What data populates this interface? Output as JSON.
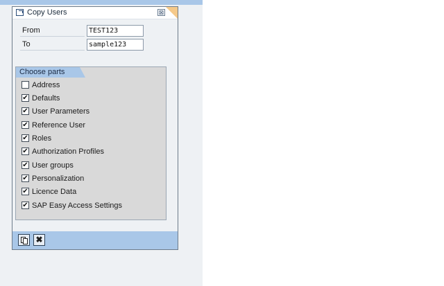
{
  "dialog": {
    "title": "Copy Users",
    "close_glyph": "⊠",
    "fields": [
      {
        "label": "From",
        "value": "TEST123"
      },
      {
        "label": "To",
        "value": "sample123"
      }
    ],
    "group": {
      "title": "Choose parts",
      "items": [
        {
          "label": "Address",
          "checked": false
        },
        {
          "label": "Defaults",
          "checked": true
        },
        {
          "label": "User Parameters",
          "checked": true
        },
        {
          "label": "Reference User",
          "checked": true
        },
        {
          "label": "Roles",
          "checked": true
        },
        {
          "label": "Authorization Profiles",
          "checked": true
        },
        {
          "label": "User groups",
          "checked": true
        },
        {
          "label": "Personalization",
          "checked": true
        },
        {
          "label": "Licence Data",
          "checked": true
        },
        {
          "label": "SAP Easy Access Settings",
          "checked": true
        }
      ]
    },
    "footer": {
      "copy_icon": "copy-icon",
      "cancel_icon": "cancel-icon",
      "cancel_glyph": "✖"
    }
  },
  "colors": {
    "accent_blue": "#a9c7e8",
    "title_tail": "#f5c98a",
    "panel_bg": "#eef1f4"
  }
}
